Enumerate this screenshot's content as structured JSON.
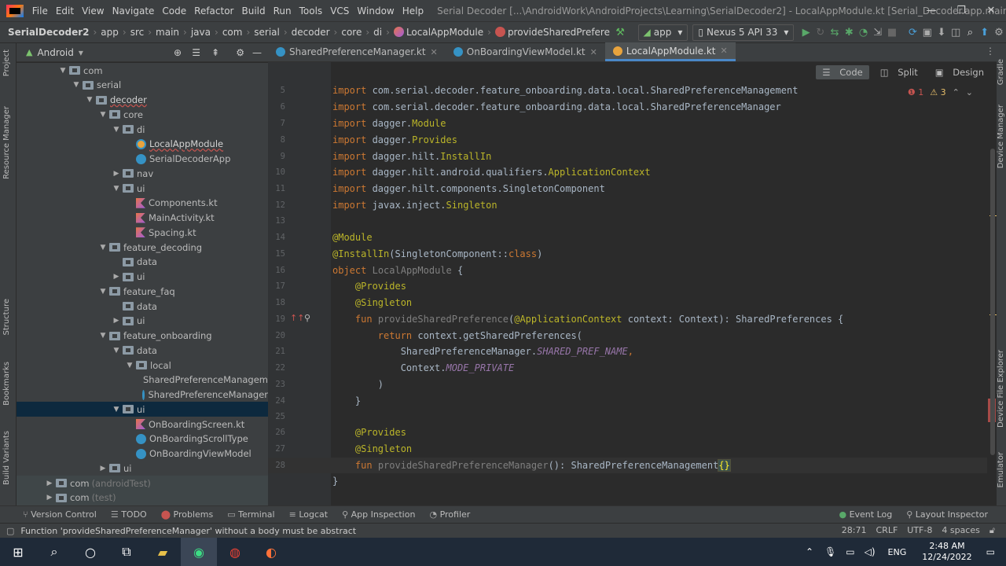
{
  "menu": {
    "items": [
      "File",
      "Edit",
      "View",
      "Navigate",
      "Code",
      "Refactor",
      "Build",
      "Run",
      "Tools",
      "VCS",
      "Window",
      "Help"
    ],
    "title": "Serial Decoder [...\\AndroidWork\\AndroidProjects\\Learning\\SerialDecoder2] - LocalAppModule.kt [Serial_Decoder.app.main]"
  },
  "nav": {
    "crumbs": [
      "SerialDecoder2",
      "app",
      "src",
      "main",
      "java",
      "com",
      "serial",
      "decoder",
      "core",
      "di"
    ],
    "file": "LocalAppModule",
    "func": "provideSharedPrefere",
    "run_config": "app",
    "device": "Nexus 5 API 33"
  },
  "project": {
    "view": "Android",
    "strip_labels": [
      "Project",
      "Resource Manager",
      "Structure",
      "Bookmarks",
      "Build Variants"
    ]
  },
  "tree": [
    {
      "label": "com",
      "depth": 3,
      "arrow": "down",
      "icon": "folder"
    },
    {
      "label": "serial",
      "depth": 4,
      "arrow": "down",
      "icon": "folder"
    },
    {
      "label": "decoder",
      "depth": 5,
      "arrow": "down",
      "icon": "folder",
      "error": true
    },
    {
      "label": "core",
      "depth": 6,
      "arrow": "down",
      "icon": "folder"
    },
    {
      "label": "di",
      "depth": 7,
      "arrow": "down",
      "icon": "folder"
    },
    {
      "label": "LocalAppModule",
      "depth": 8,
      "icon": "object",
      "error": true
    },
    {
      "label": "SerialDecoderApp",
      "depth": 8,
      "icon": "class"
    },
    {
      "label": "nav",
      "depth": 7,
      "arrow": "right",
      "icon": "folder"
    },
    {
      "label": "ui",
      "depth": 7,
      "arrow": "down",
      "icon": "folder"
    },
    {
      "label": "Components.kt",
      "depth": 8,
      "icon": "kt"
    },
    {
      "label": "MainActivity.kt",
      "depth": 8,
      "icon": "kt"
    },
    {
      "label": "Spacing.kt",
      "depth": 8,
      "icon": "kt"
    },
    {
      "label": "feature_decoding",
      "depth": 6,
      "arrow": "down",
      "icon": "folder"
    },
    {
      "label": "data",
      "depth": 7,
      "icon": "folder"
    },
    {
      "label": "ui",
      "depth": 7,
      "arrow": "right",
      "icon": "folder"
    },
    {
      "label": "feature_faq",
      "depth": 6,
      "arrow": "down",
      "icon": "folder"
    },
    {
      "label": "data",
      "depth": 7,
      "icon": "folder"
    },
    {
      "label": "ui",
      "depth": 7,
      "arrow": "right",
      "icon": "folder"
    },
    {
      "label": "feature_onboarding",
      "depth": 6,
      "arrow": "down",
      "icon": "folder"
    },
    {
      "label": "data",
      "depth": 7,
      "arrow": "down",
      "icon": "folder"
    },
    {
      "label": "local",
      "depth": 8,
      "arrow": "down",
      "icon": "folder"
    },
    {
      "label": "SharedPreferenceManageme",
      "depth": 9,
      "icon": "interface"
    },
    {
      "label": "SharedPreferenceManager",
      "depth": 9,
      "icon": "class"
    },
    {
      "label": "ui",
      "depth": 7,
      "arrow": "down",
      "icon": "folder",
      "selected": true
    },
    {
      "label": "OnBoardingScreen.kt",
      "depth": 8,
      "icon": "kt"
    },
    {
      "label": "OnBoardingScrollType",
      "depth": 8,
      "icon": "class"
    },
    {
      "label": "OnBoardingViewModel",
      "depth": 8,
      "icon": "class"
    },
    {
      "label": "ui",
      "depth": 6,
      "arrow": "right",
      "icon": "folder"
    },
    {
      "label": "com",
      "depth": 2,
      "arrow": "right",
      "icon": "folder",
      "suffix": "(androidTest)",
      "gray": true
    },
    {
      "label": "com",
      "depth": 2,
      "arrow": "right",
      "icon": "folder",
      "suffix": "(test)",
      "gray": true
    }
  ],
  "tabs": [
    {
      "label": "SharedPreferenceManager.kt",
      "active": false
    },
    {
      "label": "OnBoardingViewModel.kt",
      "active": false
    },
    {
      "label": "LocalAppModule.kt",
      "active": true
    }
  ],
  "view_modes": [
    "Code",
    "Split",
    "Design"
  ],
  "inspection": {
    "errors": "1",
    "warnings": "3"
  },
  "code_lines": [
    {
      "n": "5",
      "html": "<span class='kw'>import</span> com.serial.decoder.feature_onboarding.data.local.SharedPreferenceManagement"
    },
    {
      "n": "6",
      "html": "<span class='kw'>import</span> com.serial.decoder.feature_onboarding.data.local.SharedPreferenceManager"
    },
    {
      "n": "7",
      "html": "<span class='kw'>import</span> dagger.<span class='an'>Module</span>"
    },
    {
      "n": "8",
      "html": "<span class='kw'>import</span> dagger.<span class='an'>Provides</span>"
    },
    {
      "n": "9",
      "html": "<span class='kw'>import</span> dagger.hilt.<span class='an'>InstallIn</span>"
    },
    {
      "n": "10",
      "html": "<span class='kw'>import</span> dagger.hilt.android.qualifiers.<span class='an'>ApplicationContext</span>"
    },
    {
      "n": "11",
      "html": "<span class='kw'>import</span> dagger.hilt.components.SingletonComponent"
    },
    {
      "n": "12",
      "html": "<span class='kw'>import</span> javax.inject.<span class='an'>Singleton</span>"
    },
    {
      "n": "14",
      "html": "<span class='an'>@Module</span>"
    },
    {
      "n": "15",
      "html": "<span class='an'>@InstallIn</span>(SingletonComponent::<span class='kw'>class</span>)"
    },
    {
      "n": "16",
      "html": "<span class='kw'>object</span> <span class='unused'>LocalAppModule</span> {"
    },
    {
      "n": "17",
      "html": "    <span class='an'>@Provides</span>"
    },
    {
      "n": "18",
      "html": "    <span class='an'>@Singleton</span>"
    },
    {
      "n": "19",
      "html": "    <span class='kw'>fun</span> <span class='unused'>provideSharedPreference</span>(<span class='an'>@ApplicationContext</span> context: Context): SharedPreferences {"
    },
    {
      "n": "20",
      "html": "        <span class='kw'>return</span> context.getSharedPreferences("
    },
    {
      "n": "21",
      "html": "            SharedPreferenceManager.<span class='pur'>SHARED_PREF_NAME</span><span class='kw'>,</span>"
    },
    {
      "n": "22",
      "html": "            Context.<span class='pur'>MODE_PRIVATE</span>"
    },
    {
      "n": "23",
      "html": "        )"
    },
    {
      "n": "24",
      "html": "    }"
    },
    {
      "n": "26",
      "html": "    <span class='an'>@Provides</span>"
    },
    {
      "n": "27",
      "html": "    <span class='an'>@Singleton</span>"
    },
    {
      "n": "28",
      "html": "    <span class='kw'>fun</span> <span class='unused'>provideSharedPreferenceManager</span>(): SharedPreferenceManagement<span class='brk'>{}</span>",
      "current": true
    },
    {
      "n": "",
      "html": "}"
    }
  ],
  "toolwindows": [
    "Version Control",
    "TODO",
    "Problems",
    "Terminal",
    "Logcat",
    "App Inspection",
    "Profiler"
  ],
  "toolwindows_right": [
    "Event Log",
    "Layout Inspector"
  ],
  "status": {
    "message": "Function 'provideSharedPreferenceManager' without a body must be abstract",
    "position": "28:71",
    "line_sep": "CRLF",
    "encoding": "UTF-8",
    "indent": "4 spaces"
  },
  "right_strip": [
    "Gradle",
    "Device Manager",
    "Device File Explorer",
    "Emulator"
  ],
  "taskbar": {
    "lang": "ENG",
    "time": "2:48 AM",
    "date": "12/24/2022"
  }
}
